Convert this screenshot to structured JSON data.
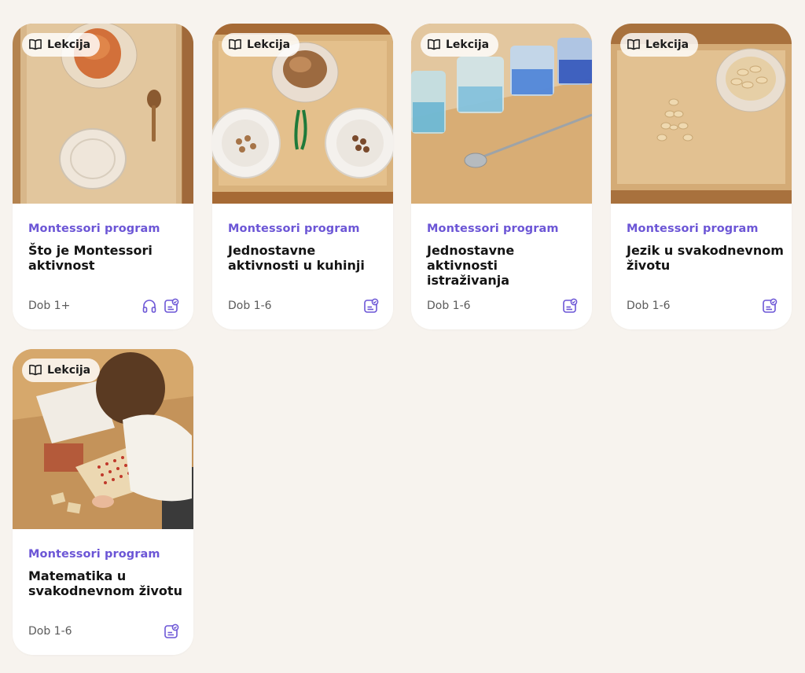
{
  "colors": {
    "background": "#f7f3ee",
    "accent": "#6c56d6",
    "card": "#ffffff"
  },
  "cards": [
    {
      "badge": "Lekcija",
      "category": "Montessori program",
      "title": "Što je Montessori aktivnost",
      "age": "Dob 1+",
      "icons": [
        "headphones-icon",
        "lesson-check-icon"
      ]
    },
    {
      "badge": "Lekcija",
      "category": "Montessori program",
      "title": "Jednostavne aktivnosti u kuhinji",
      "age": "Dob 1-6",
      "icons": [
        "lesson-check-icon"
      ]
    },
    {
      "badge": "Lekcija",
      "category": "Montessori program",
      "title": "Jednostavne aktivnosti istraživanja",
      "age": "Dob 1-6",
      "icons": [
        "lesson-check-icon"
      ]
    },
    {
      "badge": "Lekcija",
      "category": "Montessori program",
      "title": "Jezik u svakodnevnom životu",
      "age": "Dob 1-6",
      "icons": [
        "lesson-check-icon"
      ]
    },
    {
      "badge": "Lekcija",
      "category": "Montessori program",
      "title": "Matematika u svakodnevnom životu",
      "age": "Dob 1-6",
      "icons": [
        "lesson-check-icon"
      ]
    }
  ]
}
